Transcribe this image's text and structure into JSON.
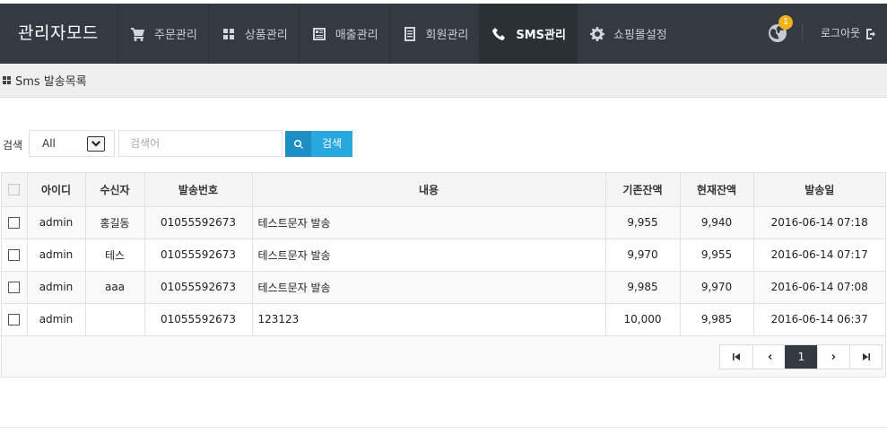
{
  "nav": {
    "brand": "관리자모드",
    "items": [
      {
        "label": "주문관리",
        "icon": "shopping-cart-icon"
      },
      {
        "label": "상품관리",
        "icon": "grid-icon"
      },
      {
        "label": "매출관리",
        "icon": "report-icon"
      },
      {
        "label": "회원관리",
        "icon": "document-icon"
      },
      {
        "label": "SMS관리",
        "icon": "phone-icon",
        "active": true
      },
      {
        "label": "쇼핑몰설정",
        "icon": "gear-icon"
      }
    ],
    "notification_count": "1",
    "logout_label": "로그아웃"
  },
  "page": {
    "title": "Sms 발송목록"
  },
  "search": {
    "label": "검색",
    "select_value": "All",
    "placeholder": "검색어",
    "button_label": "검색"
  },
  "table": {
    "columns": [
      "아이디",
      "수신자",
      "발송번호",
      "내용",
      "기존잔액",
      "현재잔액",
      "발송일"
    ],
    "rows": [
      {
        "id": "admin",
        "receiver": "홍길동",
        "sender": "01055592673",
        "content": "테스트문자 발송",
        "before": "9,955",
        "after": "9,940",
        "date": "2016-06-14 07:18"
      },
      {
        "id": "admin",
        "receiver": "테스",
        "sender": "01055592673",
        "content": "테스트문자 발송",
        "before": "9,970",
        "after": "9,955",
        "date": "2016-06-14 07:17"
      },
      {
        "id": "admin",
        "receiver": "aaa",
        "sender": "01055592673",
        "content": "테스트문자 발송",
        "before": "9,985",
        "after": "9,970",
        "date": "2016-06-14 07:08"
      },
      {
        "id": "admin",
        "receiver": "",
        "sender": "01055592673",
        "content": "123123",
        "before": "10,000",
        "after": "9,985",
        "date": "2016-06-14 06:37"
      }
    ]
  },
  "pagination": {
    "current_page": "1"
  },
  "colors": {
    "nav_bg": "#333a41",
    "accent": "#29a7df",
    "badge": "#f3b21a"
  }
}
